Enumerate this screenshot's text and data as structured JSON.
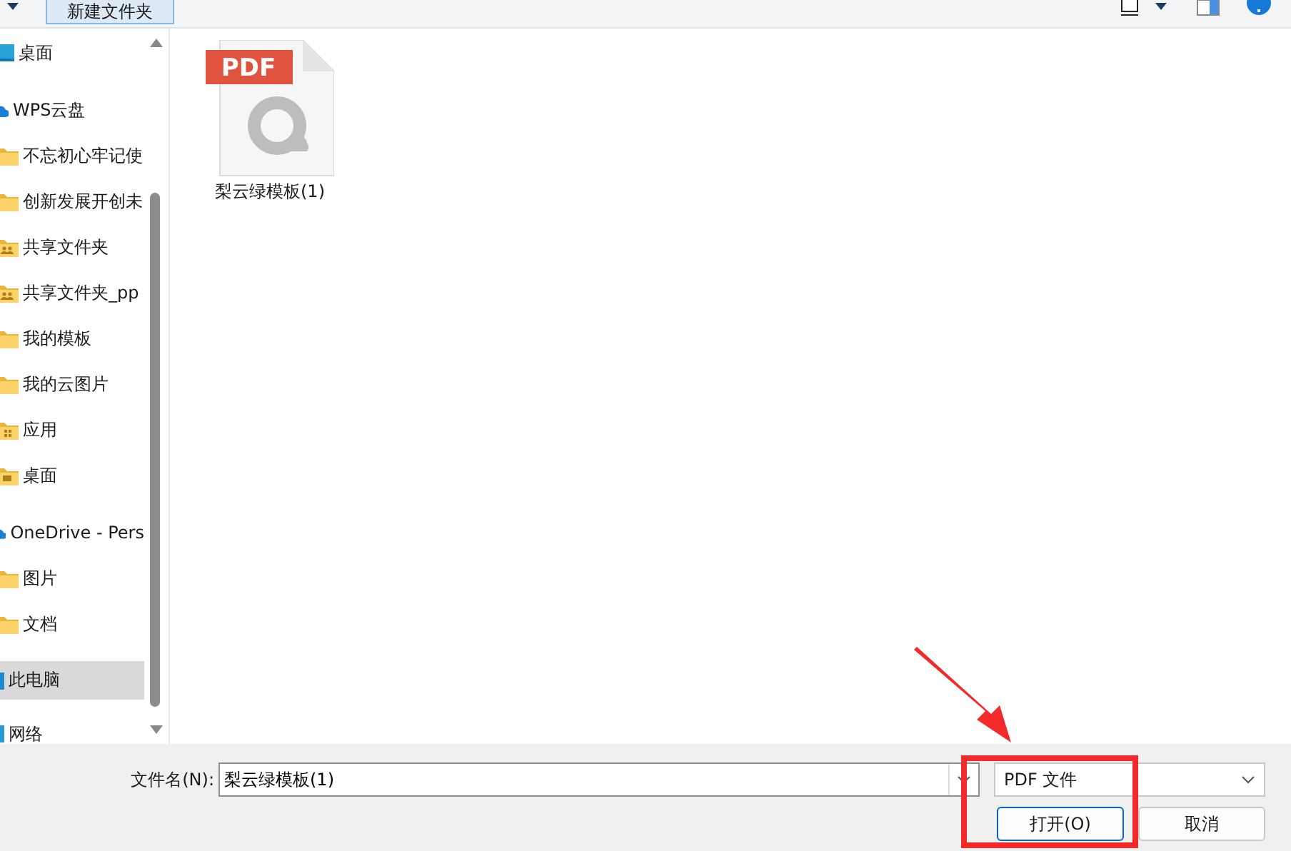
{
  "toolbar": {
    "new_folder_button": "新建文件夹"
  },
  "sidebar": {
    "items": [
      {
        "label": "桌面",
        "kind": "desktop",
        "selected": false
      },
      {
        "label": "WPS云盘",
        "kind": "cloud",
        "selected": false,
        "children": [
          {
            "label": "不忘初心牢记使",
            "kind": "folder",
            "selected": false
          },
          {
            "label": "创新发展开创未",
            "kind": "folder",
            "selected": false
          },
          {
            "label": "共享文件夹",
            "kind": "shared-folder",
            "selected": false
          },
          {
            "label": "共享文件夹_pp",
            "kind": "shared-folder",
            "selected": false
          },
          {
            "label": "我的模板",
            "kind": "folder",
            "selected": false
          },
          {
            "label": "我的云图片",
            "kind": "folder",
            "selected": false
          },
          {
            "label": "应用",
            "kind": "app-folder",
            "selected": false
          },
          {
            "label": "桌面",
            "kind": "desktop-folder",
            "selected": false
          }
        ]
      },
      {
        "label": "OneDrive - Pers",
        "kind": "cloud",
        "selected": false,
        "children": [
          {
            "label": "图片",
            "kind": "folder",
            "selected": false
          },
          {
            "label": "文档",
            "kind": "folder",
            "selected": false
          }
        ]
      },
      {
        "label": "此电脑",
        "kind": "pc",
        "selected": true
      },
      {
        "label": "网络",
        "kind": "network",
        "selected": false
      }
    ]
  },
  "files": [
    {
      "name": "梨云绿模板(1)",
      "badge": "PDF"
    }
  ],
  "filename": {
    "label": "文件名(N):",
    "value": "梨云绿模板(1)"
  },
  "file_type": {
    "value": "PDF 文件"
  },
  "buttons": [
    {
      "label": "打开(O)",
      "kind": "primary"
    },
    {
      "label": "取消",
      "kind": "normal"
    }
  ]
}
